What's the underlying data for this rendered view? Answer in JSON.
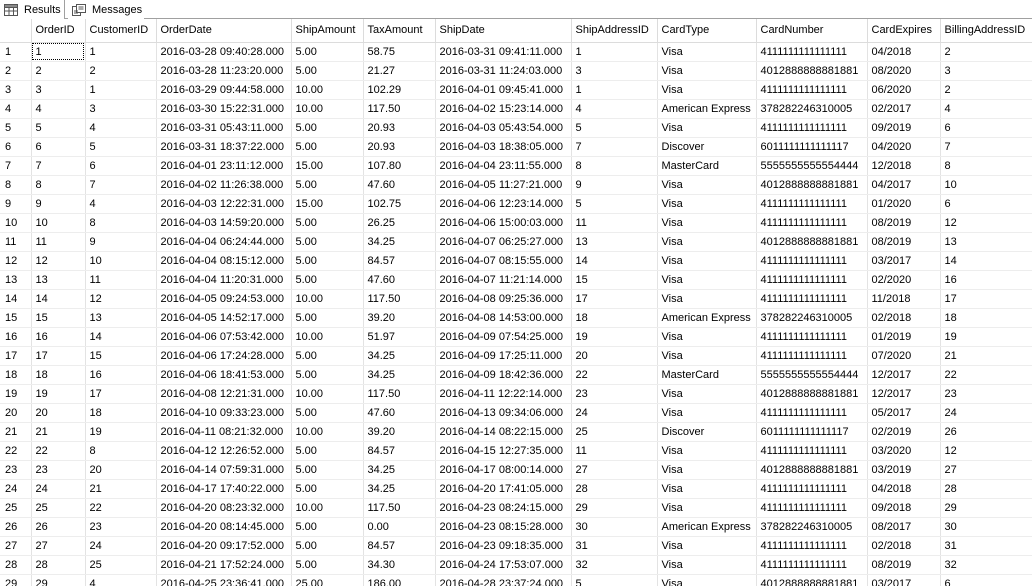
{
  "tabs": [
    {
      "label": "Results",
      "icon": "grid-icon"
    },
    {
      "label": "Messages",
      "icon": "messages-icon"
    }
  ],
  "columns": [
    "OrderID",
    "CustomerID",
    "OrderDate",
    "ShipAmount",
    "TaxAmount",
    "ShipDate",
    "ShipAddressID",
    "CardType",
    "CardNumber",
    "CardExpires",
    "BillingAddressID"
  ],
  "rows": [
    [
      "1",
      "1",
      "1",
      "2016-03-28 09:40:28.000",
      "5.00",
      "58.75",
      "2016-03-31 09:41:11.000",
      "1",
      "Visa",
      "4111111111111111",
      "04/2018",
      "2"
    ],
    [
      "2",
      "2",
      "2",
      "2016-03-28 11:23:20.000",
      "5.00",
      "21.27",
      "2016-03-31 11:24:03.000",
      "3",
      "Visa",
      "4012888888881881",
      "08/2020",
      "3"
    ],
    [
      "3",
      "3",
      "1",
      "2016-03-29 09:44:58.000",
      "10.00",
      "102.29",
      "2016-04-01 09:45:41.000",
      "1",
      "Visa",
      "4111111111111111",
      "06/2020",
      "2"
    ],
    [
      "4",
      "4",
      "3",
      "2016-03-30 15:22:31.000",
      "10.00",
      "117.50",
      "2016-04-02 15:23:14.000",
      "4",
      "American Express",
      "378282246310005",
      "02/2017",
      "4"
    ],
    [
      "5",
      "5",
      "4",
      "2016-03-31 05:43:11.000",
      "5.00",
      "20.93",
      "2016-04-03 05:43:54.000",
      "5",
      "Visa",
      "4111111111111111",
      "09/2019",
      "6"
    ],
    [
      "6",
      "6",
      "5",
      "2016-03-31 18:37:22.000",
      "5.00",
      "20.93",
      "2016-04-03 18:38:05.000",
      "7",
      "Discover",
      "6011111111111117",
      "04/2020",
      "7"
    ],
    [
      "7",
      "7",
      "6",
      "2016-04-01 23:11:12.000",
      "15.00",
      "107.80",
      "2016-04-04 23:11:55.000",
      "8",
      "MasterCard",
      "5555555555554444",
      "12/2018",
      "8"
    ],
    [
      "8",
      "8",
      "7",
      "2016-04-02 11:26:38.000",
      "5.00",
      "47.60",
      "2016-04-05 11:27:21.000",
      "9",
      "Visa",
      "4012888888881881",
      "04/2017",
      "10"
    ],
    [
      "9",
      "9",
      "4",
      "2016-04-03 12:22:31.000",
      "15.00",
      "102.75",
      "2016-04-06 12:23:14.000",
      "5",
      "Visa",
      "4111111111111111",
      "01/2020",
      "6"
    ],
    [
      "10",
      "10",
      "8",
      "2016-04-03 14:59:20.000",
      "5.00",
      "26.25",
      "2016-04-06 15:00:03.000",
      "11",
      "Visa",
      "4111111111111111",
      "08/2019",
      "12"
    ],
    [
      "11",
      "11",
      "9",
      "2016-04-04 06:24:44.000",
      "5.00",
      "34.25",
      "2016-04-07 06:25:27.000",
      "13",
      "Visa",
      "4012888888881881",
      "08/2019",
      "13"
    ],
    [
      "12",
      "12",
      "10",
      "2016-04-04 08:15:12.000",
      "5.00",
      "84.57",
      "2016-04-07 08:15:55.000",
      "14",
      "Visa",
      "4111111111111111",
      "03/2017",
      "14"
    ],
    [
      "13",
      "13",
      "11",
      "2016-04-04 11:20:31.000",
      "5.00",
      "47.60",
      "2016-04-07 11:21:14.000",
      "15",
      "Visa",
      "4111111111111111",
      "02/2020",
      "16"
    ],
    [
      "14",
      "14",
      "12",
      "2016-04-05 09:24:53.000",
      "10.00",
      "117.50",
      "2016-04-08 09:25:36.000",
      "17",
      "Visa",
      "4111111111111111",
      "11/2018",
      "17"
    ],
    [
      "15",
      "15",
      "13",
      "2016-04-05 14:52:17.000",
      "5.00",
      "39.20",
      "2016-04-08 14:53:00.000",
      "18",
      "American Express",
      "378282246310005",
      "02/2018",
      "18"
    ],
    [
      "16",
      "16",
      "14",
      "2016-04-06 07:53:42.000",
      "10.00",
      "51.97",
      "2016-04-09 07:54:25.000",
      "19",
      "Visa",
      "4111111111111111",
      "01/2019",
      "19"
    ],
    [
      "17",
      "17",
      "15",
      "2016-04-06 17:24:28.000",
      "5.00",
      "34.25",
      "2016-04-09 17:25:11.000",
      "20",
      "Visa",
      "4111111111111111",
      "07/2020",
      "21"
    ],
    [
      "18",
      "18",
      "16",
      "2016-04-06 18:41:53.000",
      "5.00",
      "34.25",
      "2016-04-09 18:42:36.000",
      "22",
      "MasterCard",
      "5555555555554444",
      "12/2017",
      "22"
    ],
    [
      "19",
      "19",
      "17",
      "2016-04-08 12:21:31.000",
      "10.00",
      "117.50",
      "2016-04-11 12:22:14.000",
      "23",
      "Visa",
      "4012888888881881",
      "12/2017",
      "23"
    ],
    [
      "20",
      "20",
      "18",
      "2016-04-10 09:33:23.000",
      "5.00",
      "47.60",
      "2016-04-13 09:34:06.000",
      "24",
      "Visa",
      "4111111111111111",
      "05/2017",
      "24"
    ],
    [
      "21",
      "21",
      "19",
      "2016-04-11 08:21:32.000",
      "10.00",
      "39.20",
      "2016-04-14 08:22:15.000",
      "25",
      "Discover",
      "6011111111111117",
      "02/2019",
      "26"
    ],
    [
      "22",
      "22",
      "8",
      "2016-04-12 12:26:52.000",
      "5.00",
      "84.57",
      "2016-04-15 12:27:35.000",
      "11",
      "Visa",
      "4111111111111111",
      "03/2020",
      "12"
    ],
    [
      "23",
      "23",
      "20",
      "2016-04-14 07:59:31.000",
      "5.00",
      "34.25",
      "2016-04-17 08:00:14.000",
      "27",
      "Visa",
      "4012888888881881",
      "03/2019",
      "27"
    ],
    [
      "24",
      "24",
      "21",
      "2016-04-17 17:40:22.000",
      "5.00",
      "34.25",
      "2016-04-20 17:41:05.000",
      "28",
      "Visa",
      "4111111111111111",
      "04/2018",
      "28"
    ],
    [
      "25",
      "25",
      "22",
      "2016-04-20 08:23:32.000",
      "10.00",
      "117.50",
      "2016-04-23 08:24:15.000",
      "29",
      "Visa",
      "4111111111111111",
      "09/2018",
      "29"
    ],
    [
      "26",
      "26",
      "23",
      "2016-04-20 08:14:45.000",
      "5.00",
      "0.00",
      "2016-04-23 08:15:28.000",
      "30",
      "American Express",
      "378282246310005",
      "08/2017",
      "30"
    ],
    [
      "27",
      "27",
      "24",
      "2016-04-20 09:17:52.000",
      "5.00",
      "84.57",
      "2016-04-23 09:18:35.000",
      "31",
      "Visa",
      "4111111111111111",
      "02/2018",
      "31"
    ],
    [
      "28",
      "28",
      "25",
      "2016-04-21 17:52:24.000",
      "5.00",
      "34.30",
      "2016-04-24 17:53:07.000",
      "32",
      "Visa",
      "4111111111111111",
      "08/2019",
      "32"
    ],
    [
      "29",
      "29",
      "4",
      "2016-04-25 23:36:41.000",
      "25.00",
      "186.00",
      "2016-04-28 23:37:24.000",
      "5",
      "Visa",
      "4012888888881881",
      "03/2017",
      "6"
    ]
  ]
}
